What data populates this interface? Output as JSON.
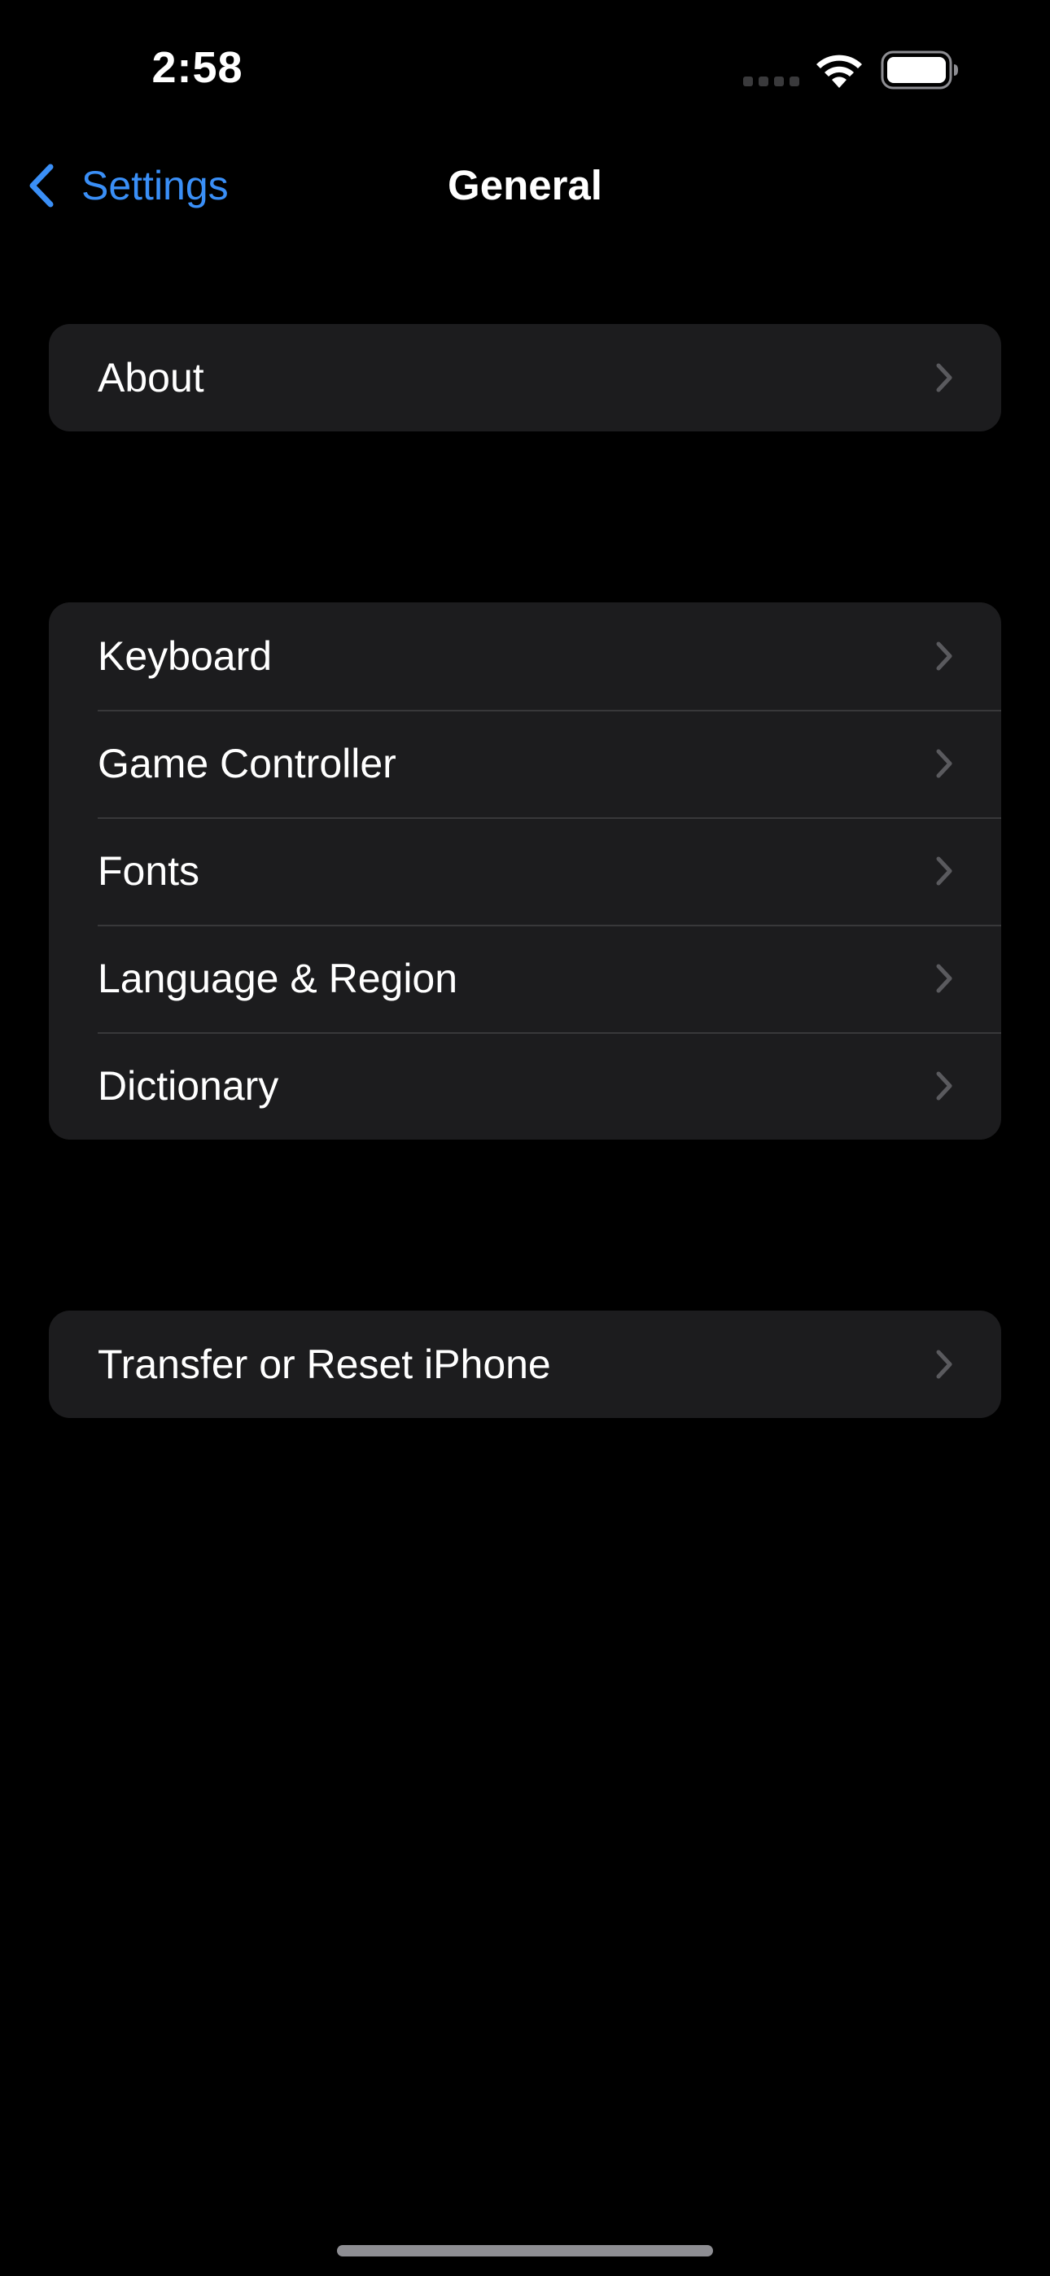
{
  "status_bar": {
    "time": "2:58",
    "icons": [
      "cellular-signal-icon",
      "wifi-icon",
      "battery-icon"
    ]
  },
  "nav": {
    "back_label": "Settings",
    "title": "General",
    "back_icon": "chevron-left-icon",
    "accent_color": "#3a8ff7"
  },
  "groups": [
    {
      "rows": [
        {
          "label": "About"
        }
      ]
    },
    {
      "rows": [
        {
          "label": "Keyboard"
        },
        {
          "label": "Game Controller"
        },
        {
          "label": "Fonts"
        },
        {
          "label": "Language & Region"
        },
        {
          "label": "Dictionary"
        }
      ]
    },
    {
      "rows": [
        {
          "label": "Transfer or Reset iPhone"
        }
      ]
    }
  ],
  "row_icon": "chevron-right-icon",
  "colors": {
    "background": "#000000",
    "cell_background": "#1c1c1e",
    "separator": "#38383a",
    "chevron": "#5a5a5e"
  }
}
